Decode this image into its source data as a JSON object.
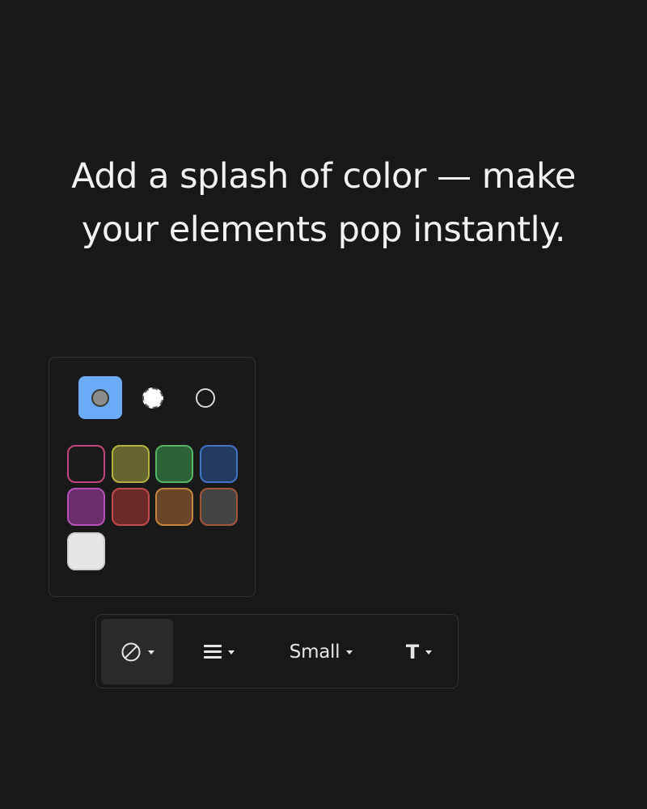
{
  "headline": {
    "line1": "Add a splash of color — make",
    "line2": "your elements pop instantly."
  },
  "color_picker": {
    "fill_modes": [
      {
        "name": "fill-solid",
        "icon": "gray-dot-icon",
        "selected": true
      },
      {
        "name": "fill-white",
        "icon": "white-dot-icon",
        "selected": false
      },
      {
        "name": "fill-none",
        "icon": "ring-dot-icon",
        "selected": false
      }
    ],
    "swatches": [
      {
        "name": "black",
        "fill": "#1b1b1b",
        "border": "#c4457c"
      },
      {
        "name": "yellow",
        "fill": "#65662f",
        "border": "#b4b23c"
      },
      {
        "name": "green",
        "fill": "#2b6236",
        "border": "#55b466"
      },
      {
        "name": "blue",
        "fill": "#233b60",
        "border": "#3f74c6"
      },
      {
        "name": "violet",
        "fill": "#6a2e6d",
        "border": "#b651b9"
      },
      {
        "name": "red",
        "fill": "#6b2a2a",
        "border": "#c24a4a"
      },
      {
        "name": "orange",
        "fill": "#6a4528",
        "border": "#c4853f"
      },
      {
        "name": "gray",
        "fill": "#444444",
        "border": "#a2563a"
      },
      {
        "name": "white",
        "fill": "#e6e6e6",
        "border": "#cfcfcf"
      }
    ]
  },
  "toolbar": {
    "color_button": {
      "icon": "no-fill-icon",
      "active": true
    },
    "stroke_button": {
      "icon": "hamburger-lines-icon"
    },
    "size_label": "Small",
    "text_button_label": "T",
    "dropdown_icon": "caret-down-icon"
  },
  "colors": {
    "background": "#181818",
    "accent": "#6aaaf7",
    "text": "#f2f2f2"
  }
}
